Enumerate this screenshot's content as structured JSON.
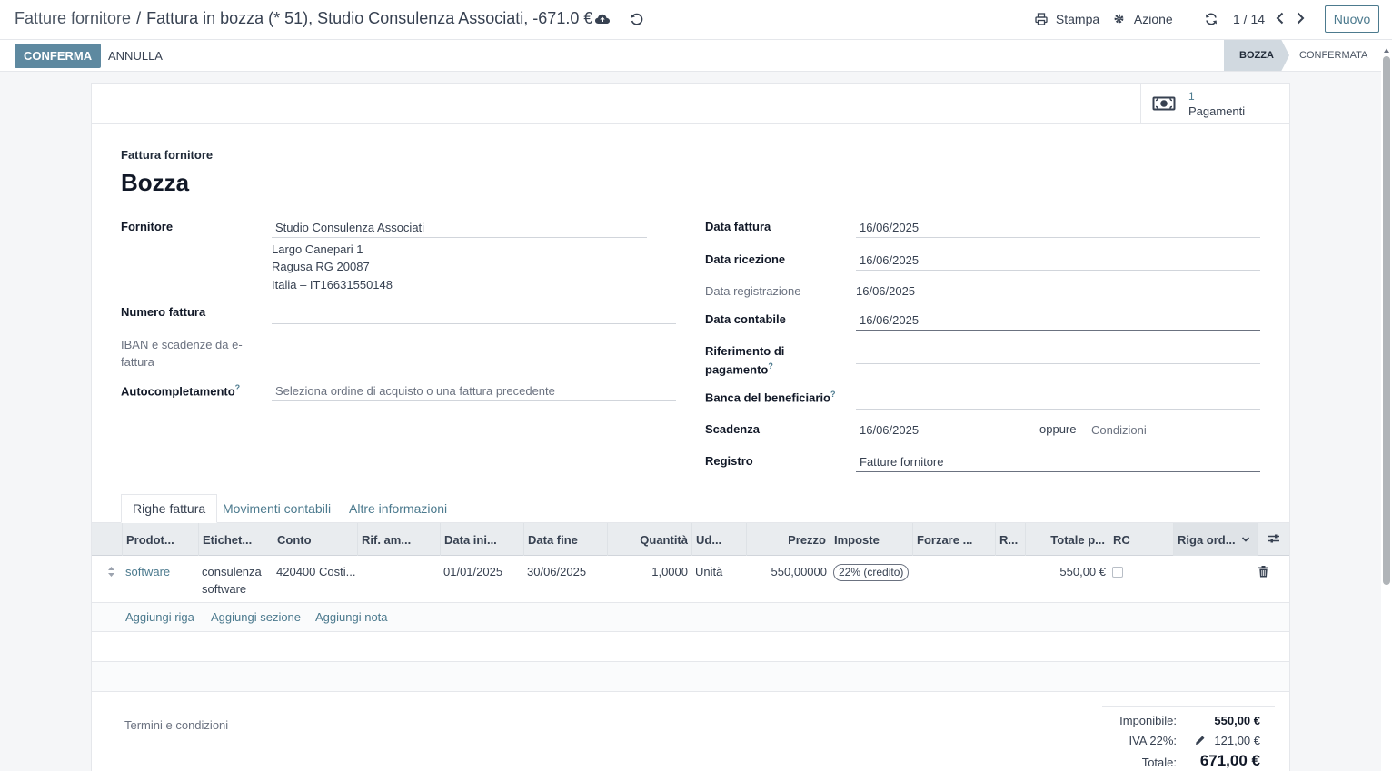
{
  "breadcrumb": {
    "parent": "Fatture fornitore",
    "separator": "/",
    "current": "Fattura in bozza (* 51), Studio Consulenza Associati, -671.0 €"
  },
  "toolbar": {
    "print_label": "Stampa",
    "action_label": "Azione",
    "pager": "1 / 14",
    "new_label": "Nuovo"
  },
  "statusbar": {
    "confirm_label": "CONFERMA",
    "cancel_label": "ANNULLA",
    "stages": [
      "BOZZA",
      "CONFERMATA"
    ],
    "active_stage": "BOZZA"
  },
  "smart_button": {
    "count": "1",
    "label": "Pagamenti"
  },
  "header": {
    "subtitle": "Fattura fornitore",
    "title": "Bozza"
  },
  "left_fields": {
    "vendor_label": "Fornitore",
    "vendor_value": "Studio Consulenza Associati",
    "address": [
      "Largo Canepari 1",
      "Ragusa RG 20087",
      "Italia – IT16631550148"
    ],
    "invoice_number_label": "Numero fattura",
    "invoice_number_value": "",
    "iban_label_1": "IBAN e scadenze da e-",
    "iban_label_2": "fattura",
    "autocomplete_label": "Autocompletamento",
    "autocomplete_help": "?",
    "autocomplete_placeholder": "Seleziona ordine di acquisto o una fattura precedente"
  },
  "right_fields": {
    "invoice_date_label": "Data fattura",
    "invoice_date_value": "16/06/2025",
    "receipt_date_label": "Data ricezione",
    "receipt_date_value": "16/06/2025",
    "registration_date_label": "Data registrazione",
    "registration_date_value": "16/06/2025",
    "accounting_date_label": "Data contabile",
    "accounting_date_value": "16/06/2025",
    "payment_ref_label_1": "Riferimento di",
    "payment_ref_label_2": "pagamento",
    "payment_ref_help": "?",
    "payment_ref_value": "",
    "bank_label": "Banca del beneficiario",
    "bank_help": "?",
    "bank_value": "",
    "due_label": "Scadenza",
    "due_value": "16/06/2025",
    "or_label": "oppure",
    "terms_placeholder": "Condizioni",
    "journal_label": "Registro",
    "journal_value": "Fatture fornitore"
  },
  "tabs": [
    "Righe fattura",
    "Movimenti contabili",
    "Altre informazioni"
  ],
  "table": {
    "columns": [
      "Prodot...",
      "Etichet...",
      "Conto",
      "Rif. am...",
      "Data ini...",
      "Data fine",
      "Quantità",
      "Ud...",
      "Prezzo",
      "Imposte",
      "Forzare ...",
      "R...",
      "Totale p...",
      "RC",
      "Riga ord..."
    ],
    "rows": [
      {
        "product": "software",
        "label_line1": "consulenza",
        "label_line2": "software",
        "account": "420400 Costi...",
        "analytic": "",
        "start_date": "01/01/2025",
        "end_date": "30/06/2025",
        "quantity": "1,0000",
        "uom": "Unità",
        "price": "550,00000",
        "tax": "22% (credito)",
        "subtotal": "550,00 €"
      }
    ],
    "add_line": "Aggiungi riga",
    "add_section": "Aggiungi sezione",
    "add_note": "Aggiungi nota"
  },
  "footer": {
    "terms_placeholder": "Termini e condizioni",
    "untaxed_label": "Imponibile:",
    "untaxed_value": "550,00 €",
    "vat_label": "IVA 22%:",
    "vat_value": "121,00 €",
    "total_label": "Totale:",
    "total_value": "671,00 €"
  },
  "colors": {
    "primary": "#5e89a0",
    "link": "#4c7a8e",
    "stage_active": "#d1d9e0"
  }
}
